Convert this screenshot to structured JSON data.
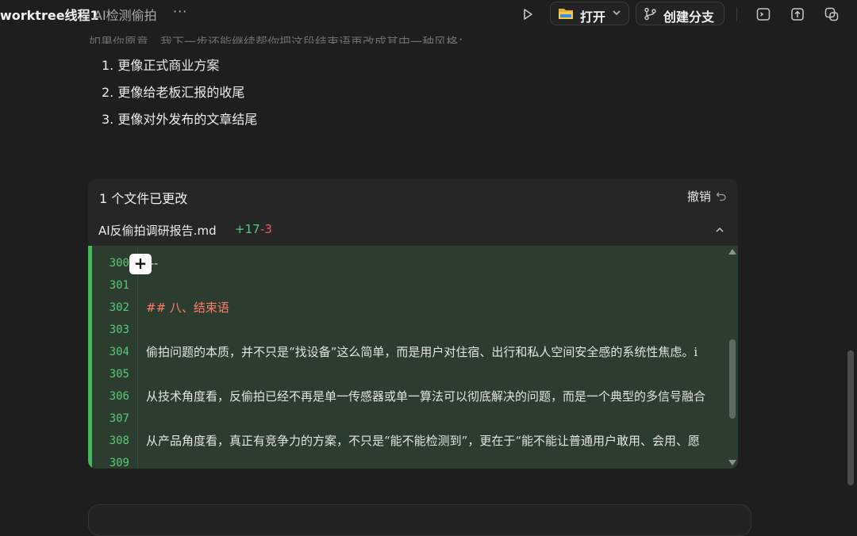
{
  "header": {
    "title": "worktree线程1",
    "subtitle": "AI检测偷拍",
    "more": "···",
    "open_label": "打开",
    "branch_label": "创建分支",
    "icons": [
      "play-icon",
      "folder-icon",
      "chevron-down-icon",
      "branch-icon",
      "terminal-icon",
      "upload-icon",
      "copy-icon"
    ]
  },
  "message": {
    "intro": "如果你愿意，我下一步还能继续帮你把这段结束语再改成其中一种风格：",
    "options": [
      "1. 更像正式商业方案",
      "2. 更像给老板汇报的收尾",
      "3. 更像对外发布的文章结尾"
    ]
  },
  "changes": {
    "summary": "1 个文件已更改",
    "undo_label": "撤销",
    "file": {
      "name": "AI反偷拍调研报告.md",
      "added": "+17",
      "removed": "-3"
    },
    "lines": [
      {
        "n": "300",
        "text": "---"
      },
      {
        "n": "301",
        "text": ""
      },
      {
        "n": "302",
        "text": "## 八、结束语"
      },
      {
        "n": "303",
        "text": ""
      },
      {
        "n": "304",
        "text": "偷拍问题的本质，并不只是“找设备”这么简单，而是用户对住宿、出行和私人空间安全感的系统性焦虑。i"
      },
      {
        "n": "305",
        "text": ""
      },
      {
        "n": "306",
        "text": "从技术角度看，反偷拍已经不再是单一传感器或单一算法可以彻底解决的问题，而是一个典型的多信号融合"
      },
      {
        "n": "307",
        "text": ""
      },
      {
        "n": "308",
        "text": "从产品角度看，真正有竞争力的方案，不只是“能不能检测到”，更在于“能不能让普通用户敢用、会用、愿"
      },
      {
        "n": "309",
        "text": ""
      }
    ],
    "plus_label": "+"
  }
}
